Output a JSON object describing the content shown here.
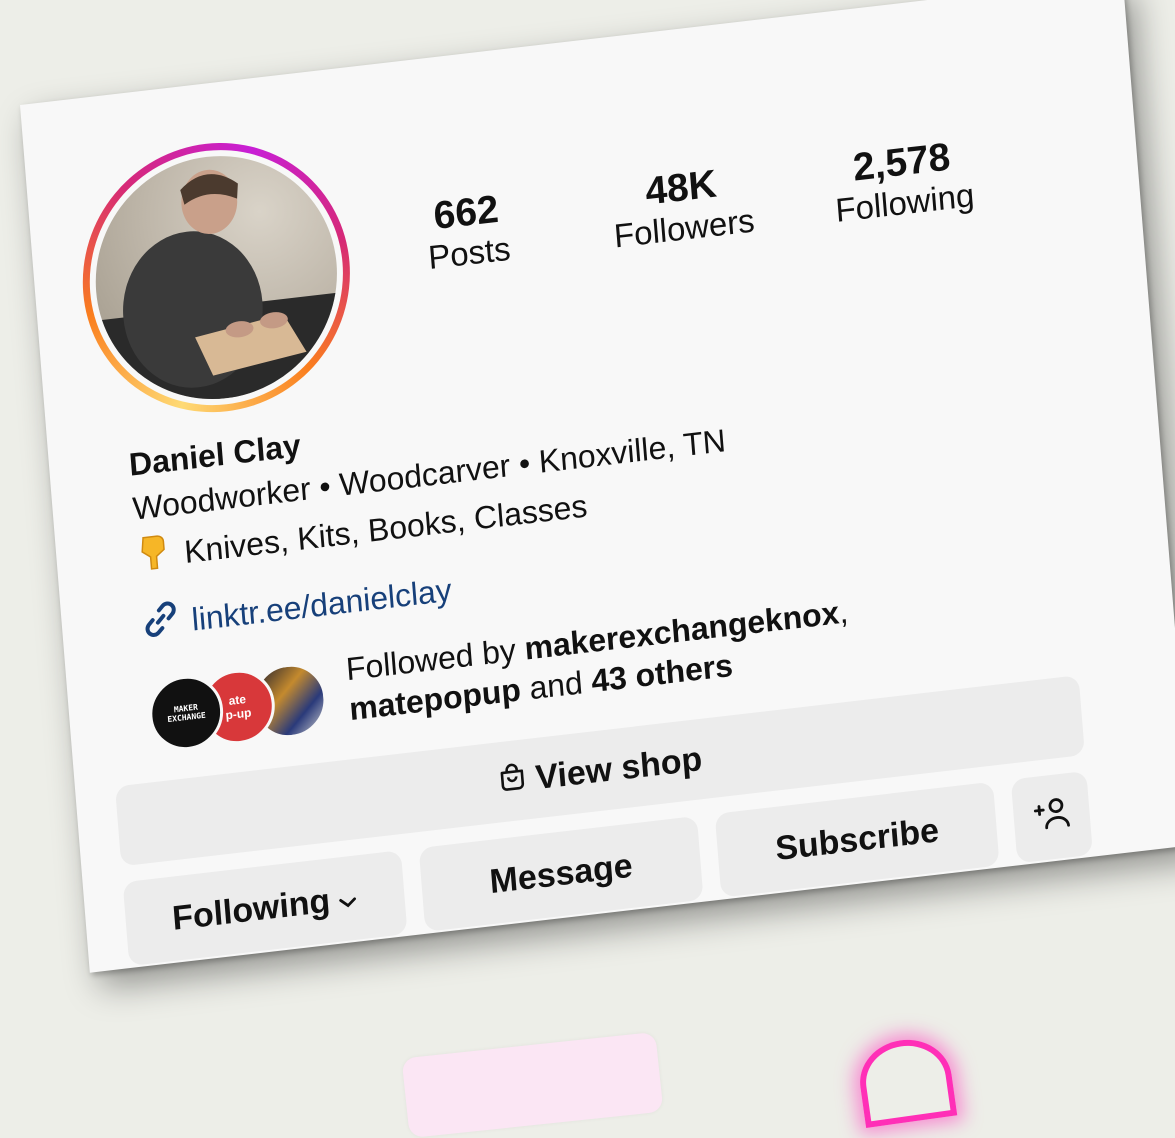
{
  "profile": {
    "stats": [
      {
        "value": "662",
        "label": "Posts"
      },
      {
        "value": "48K",
        "label": "Followers"
      },
      {
        "value": "2,578",
        "label": "Following"
      }
    ],
    "name": "Daniel Clay",
    "bio_line1": "Woodworker • Woodcarver • Knoxville, TN",
    "bio_line2": "Knives, Kits, Books, Classes",
    "bio_emoji": "pointing-down-hand-icon",
    "link": "linktr.ee/danielclay",
    "followed_by": {
      "prefix": "Followed by ",
      "user1": "makerexchangeknox",
      "sep1": ",",
      "user2": "matepopup",
      "mid": " and ",
      "others": "43 others",
      "avatar1_text_line1": "MAKER",
      "avatar1_text_line2": "EXCHANGE",
      "avatar2_text_line1": "ate",
      "avatar2_text_line2": "p-up"
    }
  },
  "actions": {
    "view_shop": "View shop",
    "following": "Following",
    "message": "Message",
    "subscribe": "Subscribe",
    "add_user_icon": "+person-icon"
  },
  "colors": {
    "link": "#17407a",
    "button_bg": "#ececec",
    "ring": [
      "#feda75",
      "#fa7e1e",
      "#d62976",
      "#c81fd6"
    ]
  }
}
